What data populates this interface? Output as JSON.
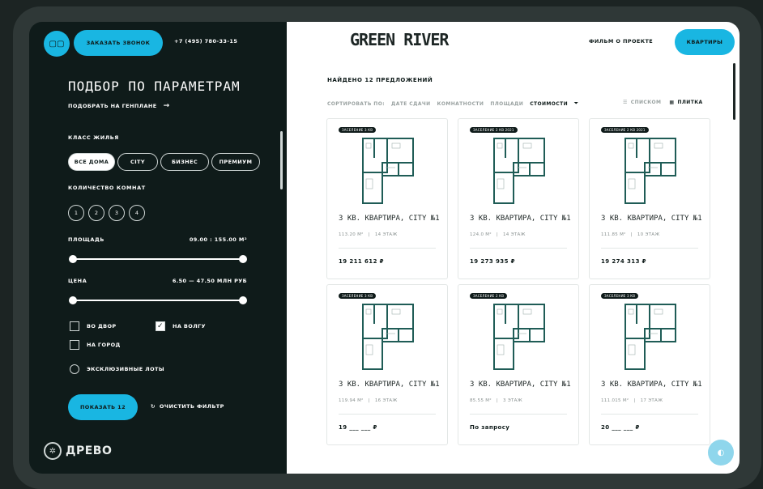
{
  "header": {
    "menu_icon": "grid-menu-icon",
    "call_button": "ЗАКАЗАТЬ ЗВОНОК",
    "phone": "+7 (495) 780-33-15",
    "brand": "GREEN RIVER",
    "film_link": "ФИЛЬМ О ПРОЕКТЕ",
    "apartments_button": "КВАРТИРЫ"
  },
  "filters": {
    "title": "ПОДБОР ПО ПАРАМЕТРАМ",
    "plan_link": "ПОДОБРАТЬ НА ГЕНПЛАНЕ",
    "class_label": "КЛАСС ЖИЛЬЯ",
    "classes": [
      "ВСЕ ДОМА",
      "CITY",
      "БИЗНЕС",
      "ПРЕМИУМ"
    ],
    "rooms_label": "КОЛИЧЕСТВО КОМНАТ",
    "rooms": [
      "1",
      "2",
      "3",
      "4"
    ],
    "area_label": "ПЛОЩАДЬ",
    "area_range": "09.00 : 155.00 М²",
    "area_slider": {
      "min_fraction": 0,
      "max_fraction": 1
    },
    "price_label": "ЦЕНА",
    "price_range": "6.50 — 47.50 МЛН РУБ",
    "price_slider": {
      "min_fraction": 0,
      "max_fraction": 1
    },
    "checks": [
      {
        "label": "ВО ДВОР",
        "checked": false
      },
      {
        "label": "НА ВОЛГУ",
        "checked": true
      },
      {
        "label": "НА ГОРОД",
        "checked": false
      }
    ],
    "exclusive_label": "ЭКСКЛЮЗИВНЫЕ ЛОТЫ",
    "show_button": "ПОКАЗАТЬ 12",
    "clear_button": "ОЧИСТИТЬ ФИЛЬТР"
  },
  "footer": {
    "logo_text": "ДРЕВО"
  },
  "results": {
    "found_text": "НАЙДЕНО 12 ПРЕДЛОЖЕНИЙ",
    "sort_label": "СОРТИРОВАТЬ ПО:",
    "sort_options": [
      "ДАТЕ СДАЧИ",
      "КОМНАТНОСТИ",
      "ПЛОЩАДИ",
      "СТОИМОСТИ"
    ],
    "sort_active": "СТОИМОСТИ",
    "view_list": "СПИСКОМ",
    "view_tiles": "ПЛИТКА",
    "cards": [
      {
        "tag": "ЗАСЕЛЕНИЕ 3 КВ",
        "title": "3 КВ. КВАРТИРА, CITY №1",
        "area": "113.20 М²",
        "floor": "14 ЭТАЖ",
        "price": "19 211 612 ₽"
      },
      {
        "tag": "ЗАСЕЛЕНИЕ 2 КВ 2021",
        "title": "3 КВ. КВАРТИРА, CITY №1",
        "area": "124.0 М²",
        "floor": "14 ЭТАЖ",
        "price": "19 273 935 ₽"
      },
      {
        "tag": "ЗАСЕЛЕНИЕ 2 КВ 2021",
        "title": "3 КВ. КВАРТИРА, CITY №1",
        "area": "111.85 М²",
        "floor": "10 ЭТАЖ",
        "price": "19 274 313 ₽"
      },
      {
        "tag": "ЗАСЕЛЕНИЕ 3 КВ",
        "title": "3 КВ. КВАРТИРА, CITY №1",
        "area": "119.94 М²",
        "floor": "16 ЭТАЖ",
        "price": "19 ___ ___ ₽"
      },
      {
        "tag": "ЗАСЕЛЕНИЕ 2 КВ",
        "title": "3 КВ. КВАРТИРА, CITY №1",
        "area": "85.55 М²",
        "floor": "3 ЭТАЖ",
        "price": "По запросу"
      },
      {
        "tag": "ЗАСЕЛЕНИЕ 3 КВ",
        "title": "3 КВ. КВАРТИРА, CITY №1",
        "area": "111.015 М²",
        "floor": "17 ЭТАЖ",
        "price": "20 ___ ___ ₽"
      }
    ]
  },
  "colors": {
    "accent": "#19b6e2",
    "panel": "#0f1b1a"
  }
}
